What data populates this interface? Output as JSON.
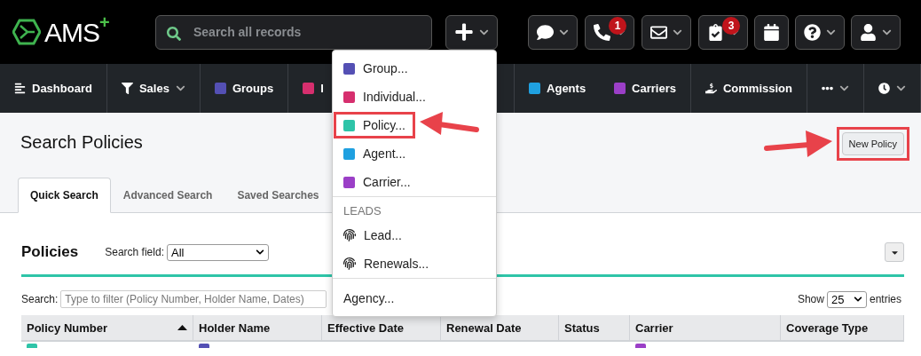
{
  "logo": {
    "text": "AMS",
    "mark": "+"
  },
  "global_search": {
    "placeholder": "Search all records"
  },
  "header_buttons": [
    {
      "kind": "create"
    },
    {
      "kind": "chat"
    },
    {
      "kind": "phone",
      "badge": "1"
    },
    {
      "kind": "mail"
    },
    {
      "kind": "tasks",
      "badge": "3"
    },
    {
      "kind": "calendar"
    },
    {
      "kind": "help"
    },
    {
      "kind": "user"
    }
  ],
  "nav_left": [
    {
      "label": "Dashboard",
      "kind": "dashboard"
    },
    {
      "label": "Sales",
      "kind": "sales"
    },
    {
      "label": "Groups",
      "kind": "record",
      "color": "#5450b4"
    },
    {
      "label": "I",
      "kind": "record",
      "color": "#d62f6e"
    }
  ],
  "nav_right": [
    {
      "label": "Agents",
      "kind": "record",
      "color": "#1fa0e0"
    },
    {
      "label": "Carriers",
      "kind": "record",
      "color": "#9b3fc7"
    },
    {
      "label": "Commission",
      "kind": "commission"
    },
    {
      "kind": "more"
    },
    {
      "kind": "recent"
    }
  ],
  "create_menu": {
    "sections": [
      {
        "items": [
          {
            "label": "Group...",
            "kind": "record",
            "color": "#5450b4",
            "highlighted": false
          },
          {
            "label": "Individual...",
            "kind": "record",
            "color": "#d62f6e",
            "highlighted": false
          },
          {
            "label": "Policy...",
            "kind": "record",
            "color": "#2ec4a8",
            "highlighted": true
          },
          {
            "label": "Agent...",
            "kind": "record",
            "color": "#1fa0e0",
            "highlighted": false
          },
          {
            "label": "Carrier...",
            "kind": "record",
            "color": "#9b3fc7",
            "highlighted": false
          }
        ]
      },
      {
        "heading": "LEADS",
        "items": [
          {
            "label": "Lead...",
            "kind": "lead",
            "highlighted": false
          },
          {
            "label": "Renewals...",
            "kind": "lead",
            "highlighted": false
          }
        ]
      },
      {
        "items": [
          {
            "label": "Agency...",
            "kind": "plain",
            "highlighted": false
          }
        ]
      }
    ]
  },
  "page": {
    "title": "Search Policies",
    "new_button": {
      "label": "New Policy",
      "highlighted": true
    },
    "tabs": [
      {
        "label": "Quick Search",
        "selected": true
      },
      {
        "label": "Advanced Search",
        "selected": false
      },
      {
        "label": "Saved Searches",
        "selected": false
      }
    ]
  },
  "policies": {
    "heading": "Policies",
    "search_field_label": "Search field:",
    "search_field_value": "All",
    "filter_label": "Search:",
    "filter_placeholder": "Type to filter (Policy Number, Holder Name, Dates)",
    "show_label": "Show",
    "page_size": "25",
    "entries_label": "entries"
  },
  "table": {
    "columns": [
      {
        "label": "Policy Number",
        "sorted": true
      },
      {
        "label": "Holder Name",
        "sorted": false
      },
      {
        "label": "Effective Date",
        "sorted": false
      },
      {
        "label": "Renewal Date",
        "sorted": false
      },
      {
        "label": "Status",
        "sorted": false
      },
      {
        "label": "Carrier",
        "sorted": false
      },
      {
        "label": "Coverage Type",
        "sorted": false
      }
    ],
    "partial_row": [
      {
        "kind": "marker",
        "color": "#2ec4a8"
      },
      {
        "kind": "marker",
        "color": "#5450b4"
      },
      {
        "kind": "blank"
      },
      {
        "kind": "blank"
      },
      {
        "kind": "blank"
      },
      {
        "kind": "marker",
        "color": "#9b3fc7"
      },
      {
        "kind": "blank"
      }
    ]
  }
}
